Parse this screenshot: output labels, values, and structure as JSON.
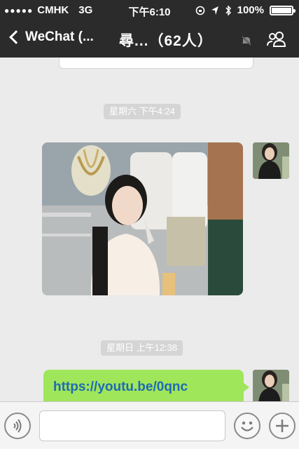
{
  "status_bar": {
    "carrier": "CMHK",
    "network": "3G",
    "time": "下午6:10",
    "battery_percent": "100%",
    "battery_level": 1.0
  },
  "nav": {
    "back_label": "WeChat (...",
    "title": "尋...（62人）",
    "icons": [
      "chevron-left-icon",
      "mute-icon",
      "group-members-icon"
    ]
  },
  "chat": {
    "messages": [
      {
        "type": "timestamp",
        "text": "星期六 下午4:24"
      },
      {
        "type": "image",
        "side": "right",
        "description_icon": "photo"
      },
      {
        "type": "timestamp",
        "text": "星期日 上午12:38"
      },
      {
        "type": "link",
        "side": "right",
        "text": "https://youtu.be/0qnc"
      }
    ]
  },
  "input_bar": {
    "placeholder": "",
    "icons": [
      "voice-icon",
      "emoji-icon",
      "plus-icon"
    ]
  },
  "colors": {
    "header_bg": "#2b2b2b",
    "chat_bg": "#ebebeb",
    "sent_bubble": "#9fe65a",
    "link_text": "#1f6bb3"
  }
}
